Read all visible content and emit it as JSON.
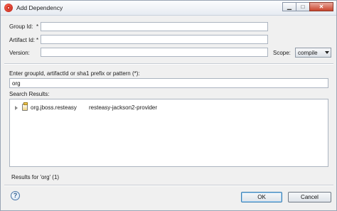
{
  "window": {
    "title": "Add Dependency",
    "minimize_glyph": "▁",
    "maximize_glyph": "□",
    "close_glyph": "✕"
  },
  "form": {
    "group_id_label": "Group Id:",
    "group_id_required": "*",
    "group_id_value": "",
    "artifact_id_label": "Artifact Id:",
    "artifact_id_required": "*",
    "artifact_id_value": "",
    "version_label": "Version:",
    "version_value": "",
    "scope_label": "Scope:",
    "scope_value": "compile"
  },
  "search": {
    "prompt_label": "Enter groupId, artifactId or sha1 prefix or pattern (*):",
    "query": "org",
    "results_label": "Search Results:",
    "results": [
      {
        "group": "org.jboss.resteasy",
        "artifact": "resteasy-jackson2-provider"
      }
    ],
    "summary": "Results for 'org' (1)"
  },
  "footer": {
    "help_glyph": "?",
    "ok_label": "OK",
    "cancel_label": "Cancel"
  },
  "icons": {
    "app": "eclipse-icon",
    "result": "jar-icon",
    "help": "help-icon"
  }
}
